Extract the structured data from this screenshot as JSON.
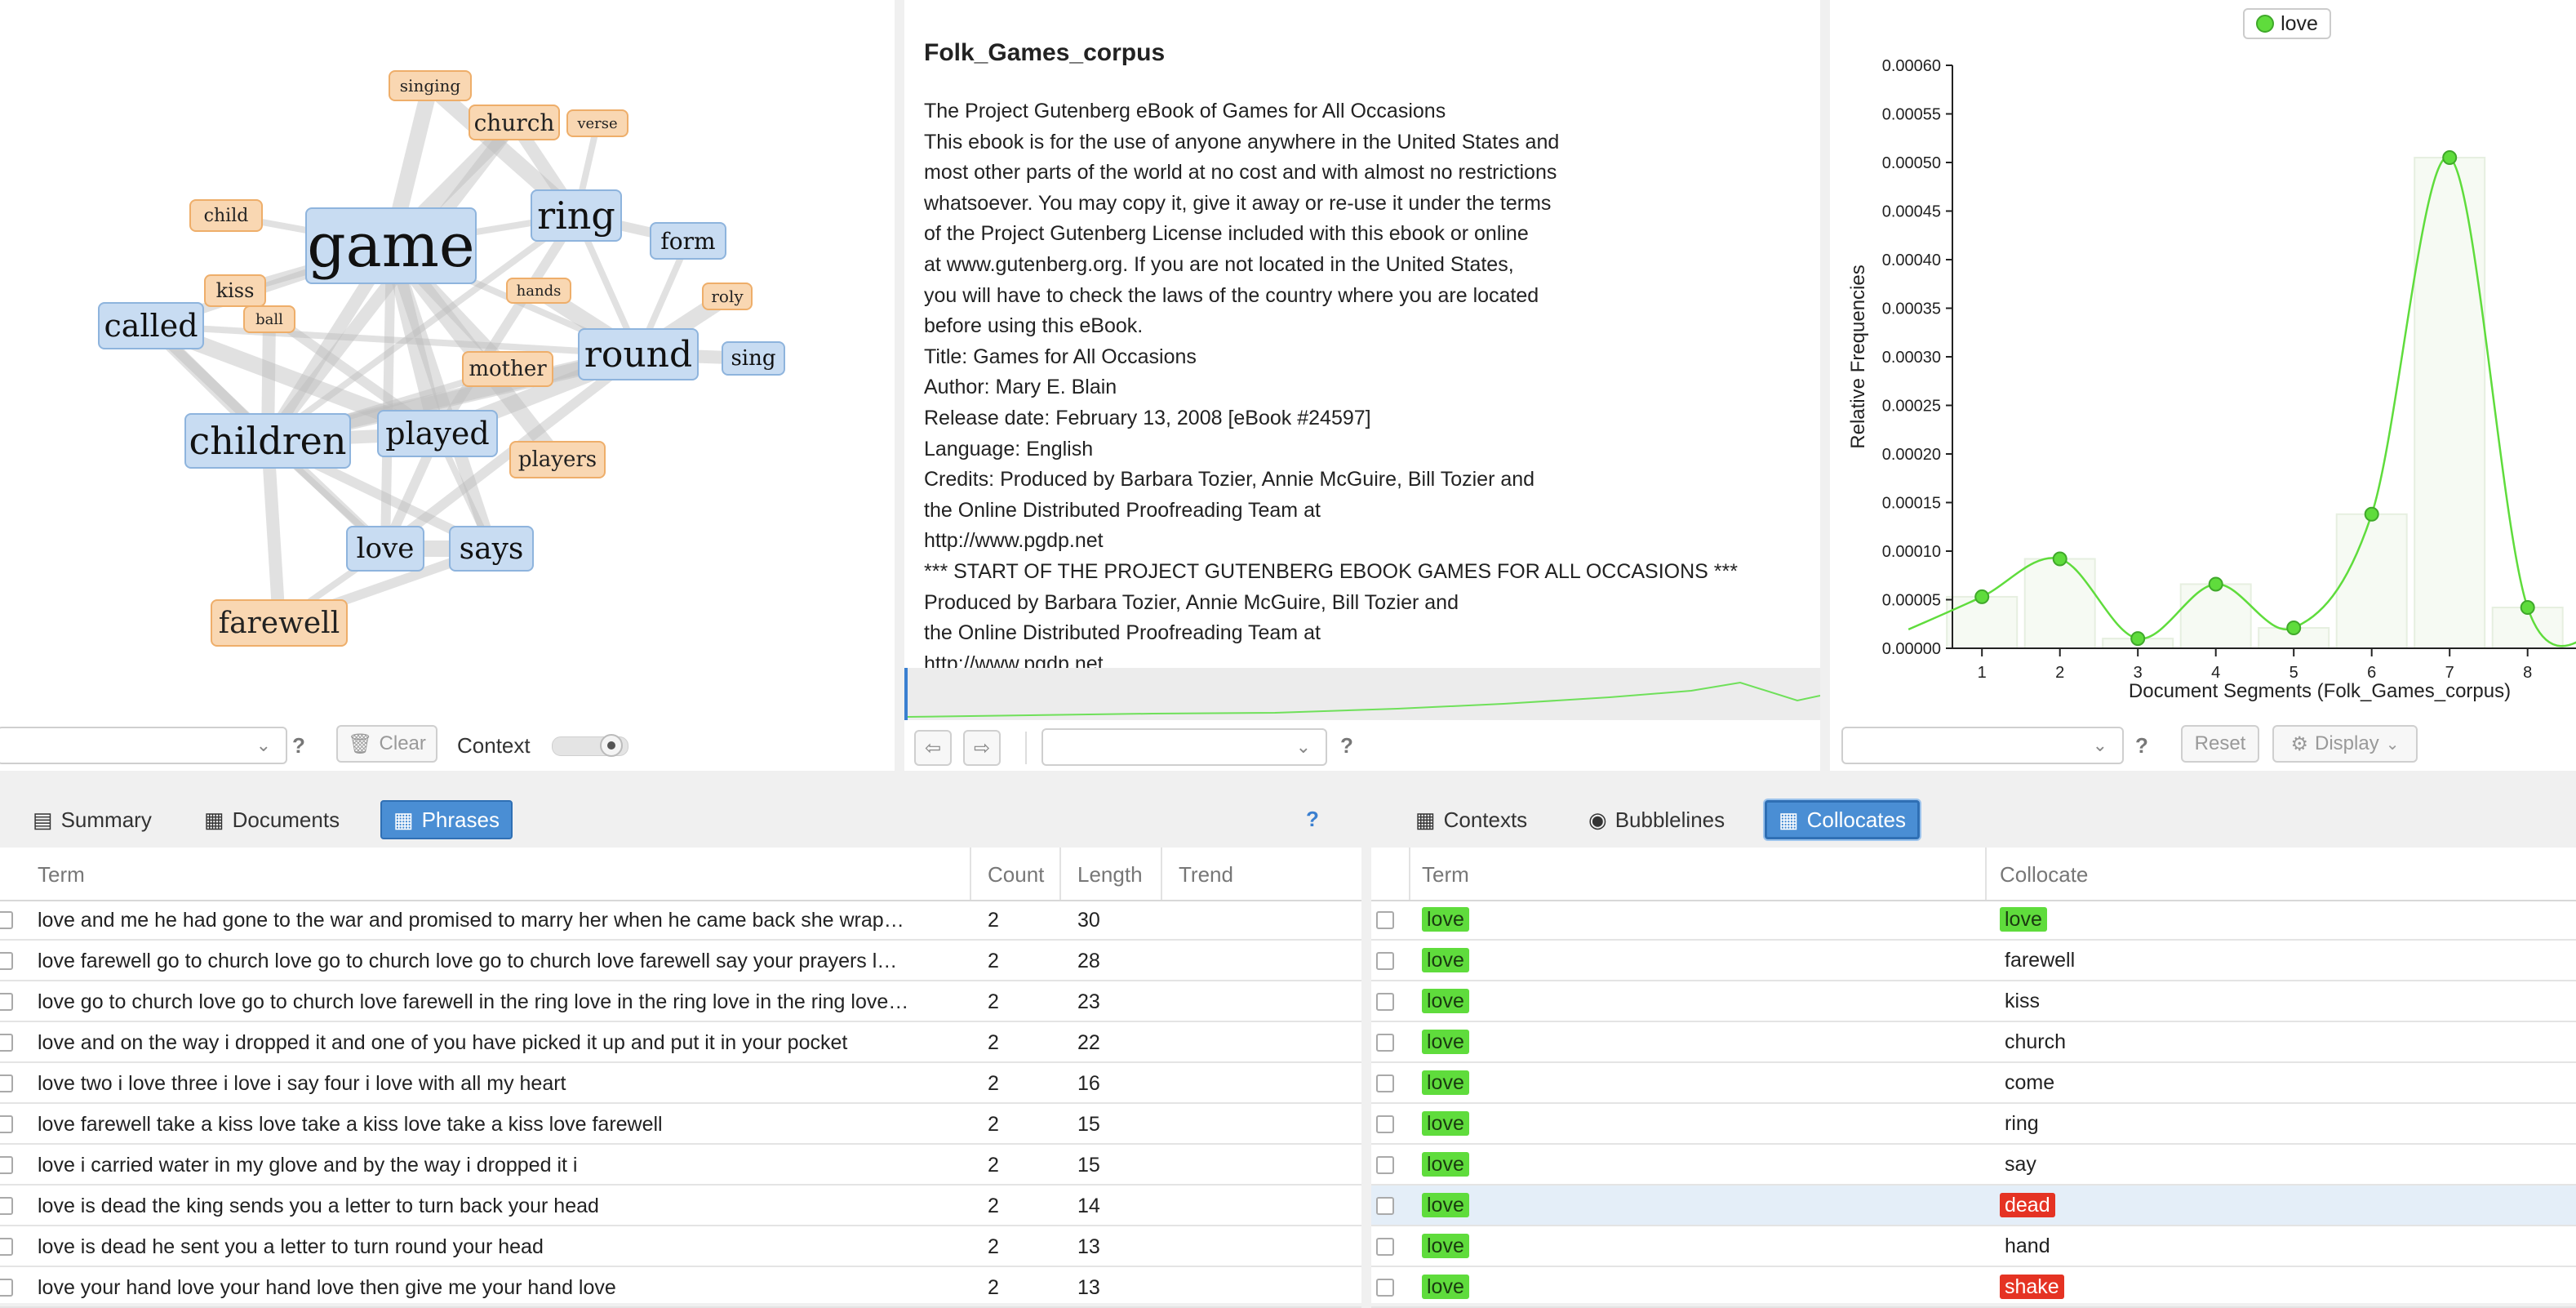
{
  "cirrus": {
    "terms": [
      {
        "text": "game",
        "style": "blue",
        "size": 74
      },
      {
        "text": "ring",
        "style": "blue",
        "size": 46
      },
      {
        "text": "called",
        "style": "blue",
        "size": 38
      },
      {
        "text": "children",
        "style": "blue",
        "size": 46
      },
      {
        "text": "played",
        "style": "blue",
        "size": 38
      },
      {
        "text": "round",
        "style": "blue",
        "size": 44
      },
      {
        "text": "form",
        "style": "blue",
        "size": 28
      },
      {
        "text": "sing",
        "style": "blue",
        "size": 26
      },
      {
        "text": "love",
        "style": "blue",
        "size": 34
      },
      {
        "text": "says",
        "style": "blue",
        "size": 36
      },
      {
        "text": "farewell",
        "style": "orange",
        "size": 36
      },
      {
        "text": "singing",
        "style": "orange",
        "size": 20
      },
      {
        "text": "church",
        "style": "orange",
        "size": 28
      },
      {
        "text": "verse",
        "style": "orange",
        "size": 18
      },
      {
        "text": "child",
        "style": "orange",
        "size": 22
      },
      {
        "text": "kiss",
        "style": "orange",
        "size": 24
      },
      {
        "text": "ball",
        "style": "orange",
        "size": 18
      },
      {
        "text": "hands",
        "style": "orange",
        "size": 18
      },
      {
        "text": "roly",
        "style": "orange",
        "size": 20
      },
      {
        "text": "mother",
        "style": "orange",
        "size": 26
      },
      {
        "text": "players",
        "style": "orange",
        "size": 26
      }
    ],
    "clear_label": "Clear",
    "context_label": "Context",
    "help": "?"
  },
  "reader": {
    "title": "Folk_Games_corpus",
    "lines": [
      "The Project Gutenberg eBook of Games for All Occasions",
      "This ebook is for the use of anyone anywhere in the United States and",
      "most other parts of the world at no cost and with almost no restrictions",
      "whatsoever. You may copy it, give it away or re-use it under the terms",
      "of the Project Gutenberg License included with this ebook or online",
      "at www.gutenberg.org. If you are not located in the United States,",
      "you will have to check the laws of the country where you are located",
      "before using this eBook.",
      "Title: Games for All Occasions",
      "Author: Mary E. Blain",
      "Release date: February 13, 2008 [eBook #24597]",
      "Language: English",
      "Credits: Produced by Barbara Tozier, Annie McGuire, Bill Tozier and",
      "the Online Distributed Proofreading Team at",
      "http://www.pgdp.net",
      "*** START OF THE PROJECT GUTENBERG EBOOK GAMES FOR ALL OCCASIONS ***",
      "Produced by Barbara Tozier, Annie McGuire, Bill Tozier and",
      "the Online Distributed Proofreading Team at",
      "http://www.pgdp.net"
    ],
    "help": "?"
  },
  "trends": {
    "legend": "love",
    "reset_label": "Reset",
    "display_label": "Display",
    "help": "?"
  },
  "chart_data": {
    "type": "line",
    "title": "",
    "xlabel": "Document Segments (Folk_Games_corpus)",
    "ylabel": "Relative Frequencies",
    "x": [
      1,
      2,
      3,
      4,
      5,
      6,
      7,
      8
    ],
    "series": [
      {
        "name": "love",
        "values": [
          5.3e-05,
          9.2e-05,
          1e-05,
          6.6e-05,
          2.1e-05,
          0.000138,
          0.000505,
          4.2e-05
        ],
        "color": "#5fdc3c"
      }
    ],
    "yticks": [
      "0.00000",
      "0.00005",
      "0.00010",
      "0.00015",
      "0.00020",
      "0.00025",
      "0.00030",
      "0.00035",
      "0.00040",
      "0.00045",
      "0.00050",
      "0.00055",
      "0.00060"
    ],
    "ylim": [
      0,
      0.0006
    ],
    "grid": false,
    "legend_position": "top"
  },
  "left_tabs": [
    "Summary",
    "Documents",
    "Phrases"
  ],
  "left_help": "?",
  "right_tabs": [
    "Contexts",
    "Bubblelines",
    "Collocates"
  ],
  "phrases": {
    "headers": [
      "Term",
      "Count",
      "Length",
      "Trend"
    ],
    "rows": [
      {
        "term": "love and me he had gone to the war and promised to marry her when he came back she wrap…",
        "count": "2",
        "length": "30"
      },
      {
        "term": "love farewell go to church love go to church love go to church love farewell say your prayers l…",
        "count": "2",
        "length": "28"
      },
      {
        "term": "love go to church love go to church love farewell in the ring love in the ring love in the ring love…",
        "count": "2",
        "length": "23"
      },
      {
        "term": "love and on the way i dropped it and one of you have picked it up and put it in your pocket",
        "count": "2",
        "length": "22"
      },
      {
        "term": "love two i love three i love i say four i love with all my heart",
        "count": "2",
        "length": "16"
      },
      {
        "term": "love farewell take a kiss love take a kiss love take a kiss love farewell",
        "count": "2",
        "length": "15"
      },
      {
        "term": "love i carried water in my glove and by the way i dropped it i",
        "count": "2",
        "length": "15"
      },
      {
        "term": "love is dead the king sends you a letter to turn back your head",
        "count": "2",
        "length": "14"
      },
      {
        "term": "love is dead he sent you a letter to turn round your head",
        "count": "2",
        "length": "13"
      },
      {
        "term": "love your hand love your hand love then give me your hand love",
        "count": "2",
        "length": "13"
      }
    ]
  },
  "collocates": {
    "headers": [
      "Term",
      "Collocate"
    ],
    "rows": [
      {
        "term": "love",
        "collocate": "love",
        "ccolor": "green"
      },
      {
        "term": "love",
        "collocate": "farewell",
        "ccolor": "none"
      },
      {
        "term": "love",
        "collocate": "kiss",
        "ccolor": "none"
      },
      {
        "term": "love",
        "collocate": "church",
        "ccolor": "none"
      },
      {
        "term": "love",
        "collocate": "come",
        "ccolor": "none"
      },
      {
        "term": "love",
        "collocate": "ring",
        "ccolor": "none"
      },
      {
        "term": "love",
        "collocate": "say",
        "ccolor": "none"
      },
      {
        "term": "love",
        "collocate": "dead",
        "ccolor": "red"
      },
      {
        "term": "love",
        "collocate": "hand",
        "ccolor": "none"
      },
      {
        "term": "love",
        "collocate": "shake",
        "ccolor": "red"
      }
    ]
  }
}
